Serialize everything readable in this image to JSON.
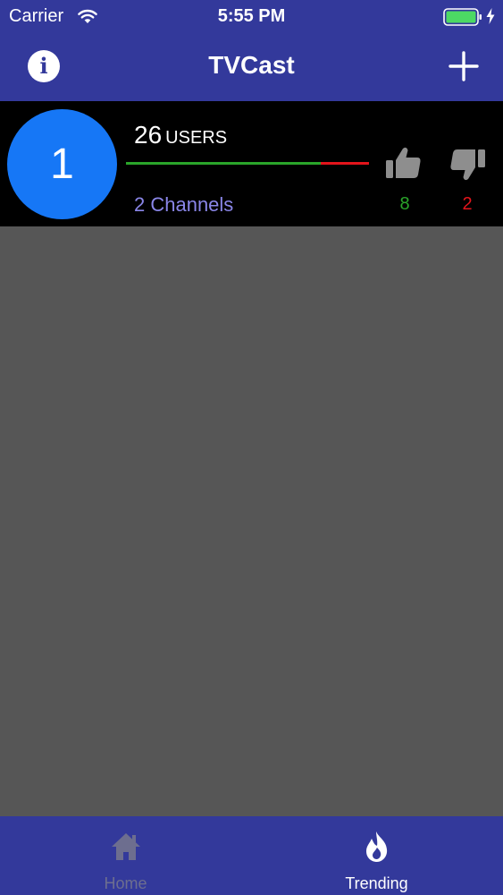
{
  "status_bar": {
    "carrier": "Carrier",
    "time": "5:55 PM",
    "battery_color": "#4cd964"
  },
  "nav": {
    "title": "TVCast",
    "info_icon": "info-icon",
    "info_glyph": "i",
    "add_icon": "plus-icon"
  },
  "list": {
    "items": [
      {
        "rank": "1",
        "users_count": "26",
        "users_label": "USERS",
        "channels": "2 Channels",
        "likes": "8",
        "dislikes": "2",
        "like_fraction": 0.8
      }
    ]
  },
  "tabs": [
    {
      "label": "Home",
      "icon": "home-icon",
      "active": false
    },
    {
      "label": "Trending",
      "icon": "flame-icon",
      "active": true
    }
  ],
  "colors": {
    "primary": "#33399b",
    "rank_circle": "#1677f6",
    "like": "#2aa52a",
    "dislike": "#e3141b",
    "channels": "#8a86e8",
    "background": "#565656"
  }
}
